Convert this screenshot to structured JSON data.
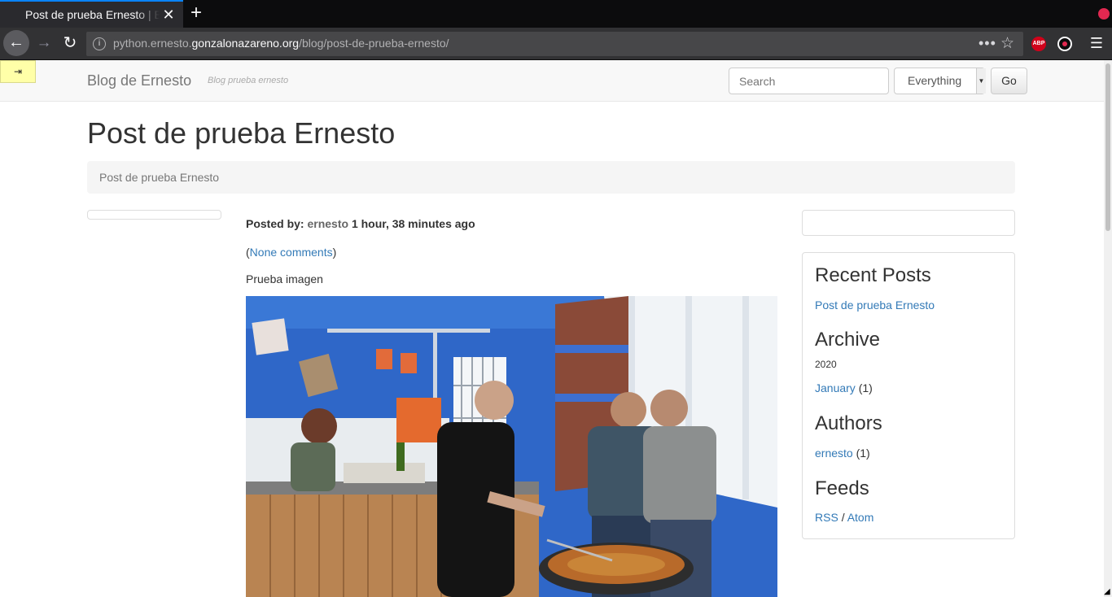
{
  "browser": {
    "tab_title": "Post de prueba Ernesto | B",
    "tab_close_icon": "close-icon",
    "new_tab_icon": "plus-icon",
    "url_scheme_host": "python.ernesto.",
    "url_domain": "gonzalonazareno.org",
    "url_path": "/blog/post-de-prueba-ernesto/",
    "page_actions_label": "•••",
    "extension_abp_label": "ABP",
    "colors": {
      "tab_accent": "#0a84ff",
      "record_dot": "#e22850",
      "abp": "#d0021b"
    }
  },
  "header": {
    "toggle_label": "⇥",
    "brand": "Blog de Ernesto",
    "tagline": "Blog prueba ernesto",
    "search_placeholder": "Search",
    "scope_selected": "Everything",
    "go_label": "Go"
  },
  "post": {
    "title": "Post de prueba Ernesto",
    "breadcrumb": "Post de prueba Ernesto",
    "posted_by_label": "Posted by:",
    "author": "ernesto",
    "time_ago": "1 hour, 38 minutes ago",
    "comments_open": "(",
    "comments_link": "None comments",
    "comments_close": ")",
    "body": "Prueba imagen",
    "image_icon": "photo-image"
  },
  "sidebar": {
    "recent_heading": "Recent Posts",
    "recent_posts": [
      "Post de prueba Ernesto"
    ],
    "archive_heading": "Archive",
    "archive_year": "2020",
    "archive_month": "January",
    "archive_month_count": "(1)",
    "authors_heading": "Authors",
    "author_name": "ernesto",
    "author_count": "(1)",
    "feeds_heading": "Feeds",
    "feed_rss": "RSS",
    "feed_separator": "/",
    "feed_atom": "Atom",
    "link_color": "#337ab7"
  }
}
